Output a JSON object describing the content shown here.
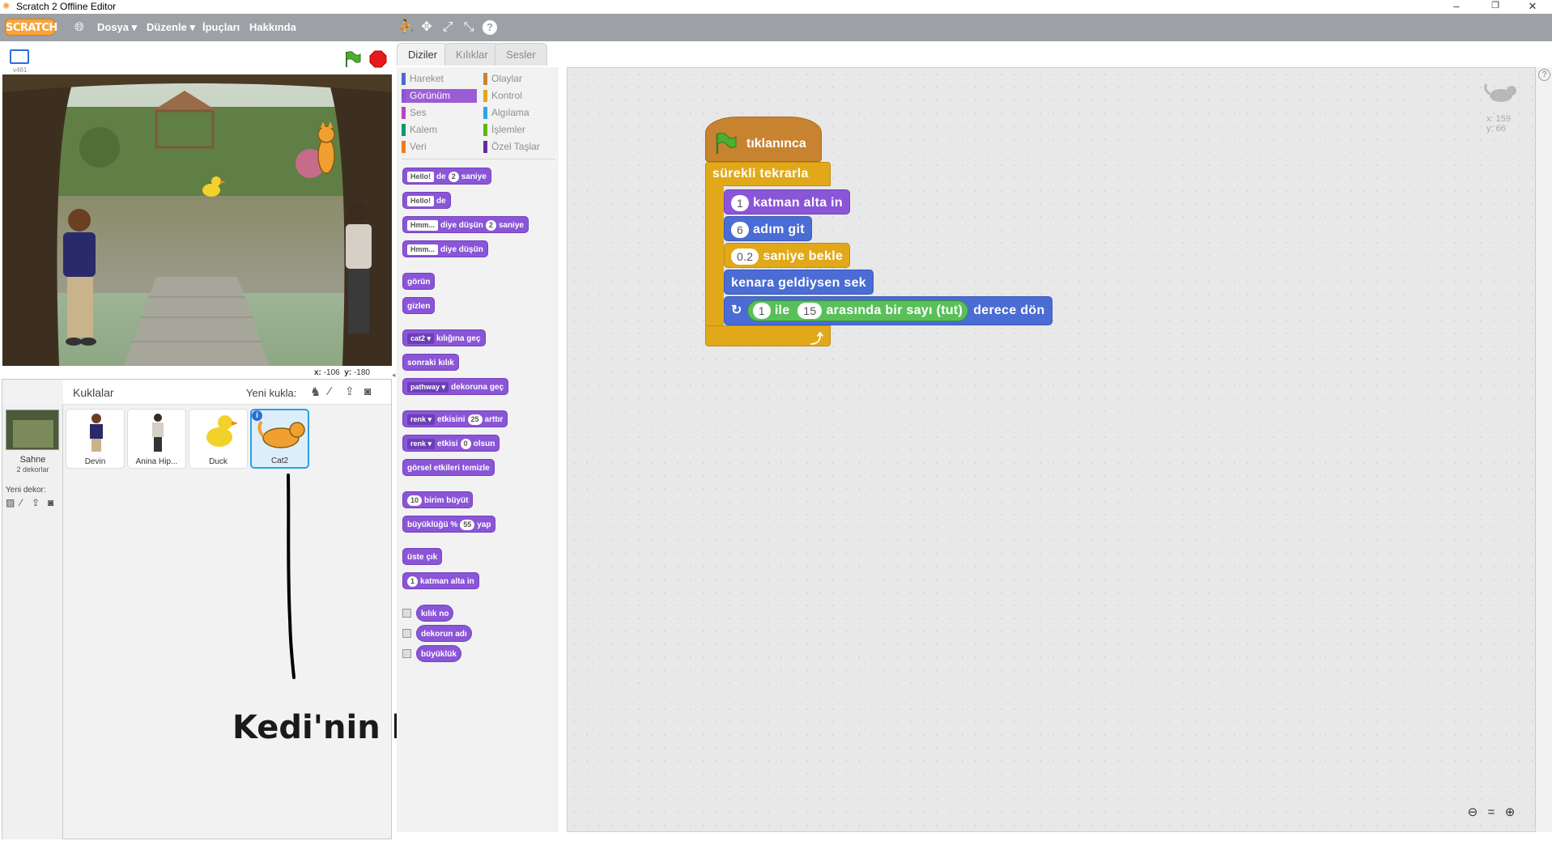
{
  "window": {
    "title": "Scratch 2 Offline Editor"
  },
  "menubar": {
    "logo": "SCRATCH",
    "items": [
      "Dosya ▾",
      "Düzenle ▾",
      "İpuçları",
      "Hakkında"
    ]
  },
  "stage": {
    "version": "v461",
    "mouse_x_label": "x:",
    "mouse_x": "-106",
    "mouse_y_label": "y:",
    "mouse_y": "-180"
  },
  "sprites": {
    "header": "Kuklalar",
    "new_sprite_label": "Yeni kukla:",
    "stage_label": "Sahne",
    "stage_sub": "2 dekorlar",
    "new_backdrop_label": "Yeni dekor:",
    "list": [
      "Devin",
      "Anina Hip...",
      "Duck",
      "Cat2"
    ],
    "selected": "Cat2"
  },
  "tabs": [
    "Diziler",
    "Kılıklar",
    "Sesler"
  ],
  "categories": {
    "left": [
      {
        "label": "Hareket",
        "color": "#4a6cd4"
      },
      {
        "label": "Görünüm",
        "color": "#8a55d7"
      },
      {
        "label": "Ses",
        "color": "#bb42c3"
      },
      {
        "label": "Kalem",
        "color": "#0e9a6c"
      },
      {
        "label": "Veri",
        "color": "#ee7d16"
      }
    ],
    "right": [
      {
        "label": "Olaylar",
        "color": "#c88330"
      },
      {
        "label": "Kontrol",
        "color": "#e1a91a"
      },
      {
        "label": "Algılama",
        "color": "#2ca5e2"
      },
      {
        "label": "İşlemler",
        "color": "#5cb712"
      },
      {
        "label": "Özel Taşlar",
        "color": "#632d99"
      }
    ],
    "selected": "Görünüm"
  },
  "palette": {
    "say_secs": {
      "text": "Hello!",
      "mid": "de",
      "num": "2",
      "end": "saniye"
    },
    "say": {
      "text": "Hello!",
      "end": "de"
    },
    "think_secs": {
      "text": "Hmm...",
      "mid": "diye düşün",
      "num": "2",
      "end": "saniye"
    },
    "think": {
      "text": "Hmm...",
      "end": "diye düşün"
    },
    "show": "görün",
    "hide": "gizlen",
    "switch_costume": {
      "drop": "cat2",
      "end": "kılığına geç"
    },
    "next_costume": "sonraki kılık",
    "switch_backdrop": {
      "drop": "pathway",
      "end": "dekoruna geç"
    },
    "change_effect": {
      "drop": "renk",
      "mid": "etkisini",
      "num": "25",
      "end": "arttır"
    },
    "set_effect": {
      "drop": "renk",
      "mid": "etkisi",
      "num": "0",
      "end": "olsun"
    },
    "clear_effects": "görsel etkileri temizle",
    "change_size": {
      "num": "10",
      "end": "birim büyüt"
    },
    "set_size": {
      "start": "büyüklüğü %",
      "num": "55",
      "end": "yap"
    },
    "front": "üste çık",
    "back_layer": {
      "num": "1",
      "end": "katman alta in"
    },
    "reporters": [
      "kılık no",
      "dekorun adı",
      "büyüklük"
    ]
  },
  "script": {
    "hat": "tıklanınca",
    "forever": "sürekli tekrarla",
    "go_back": {
      "num": "1",
      "text": "katman alta in"
    },
    "move": {
      "num": "6",
      "text": "adım git"
    },
    "wait": {
      "num": "0.2",
      "text": "saniye bekle"
    },
    "bounce": "kenara geldiysen sek",
    "turn": {
      "n1": "1",
      "ile": "ile",
      "n2": "15",
      "rnd": "arasında bir sayı (tut)",
      "end": "derece dön"
    }
  },
  "sprite_info": {
    "x_label": "x:",
    "x": "159",
    "y_label": "y:",
    "y": "66"
  },
  "zoom": {
    "out": "−",
    "reset": "=",
    "in": "+"
  },
  "annotation": "Kedi'nin kodları",
  "colors": {
    "looks": "#8a55d7",
    "motion": "#4a6cd4",
    "control": "#e1a91a",
    "events": "#c88330",
    "operators": "#59c059",
    "menubar": "#9da1a6"
  }
}
